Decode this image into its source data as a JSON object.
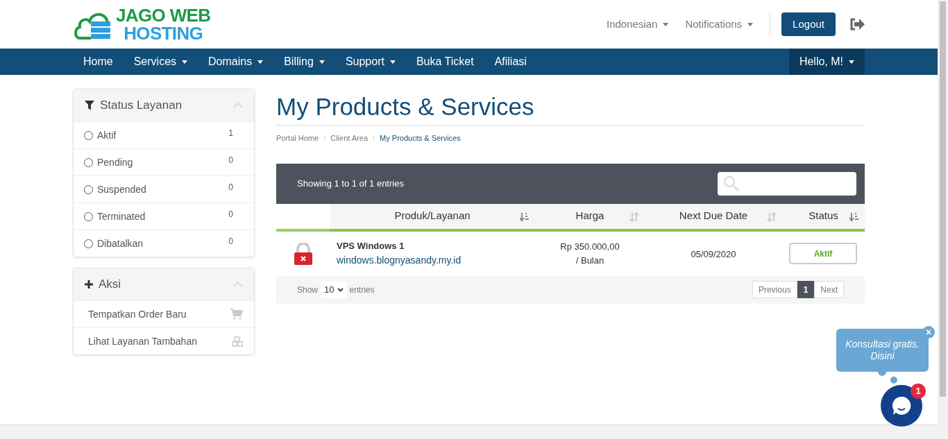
{
  "logo": {
    "line1": "JAGO WEB",
    "line2": "HOSTING"
  },
  "top_links": [
    {
      "label": "Indonesian",
      "dropdown": true
    },
    {
      "label": "Notifications",
      "dropdown": true
    }
  ],
  "logout": "Logout",
  "nav": [
    {
      "label": "Home",
      "dropdown": false
    },
    {
      "label": "Services",
      "dropdown": true
    },
    {
      "label": "Domains",
      "dropdown": true
    },
    {
      "label": "Billing",
      "dropdown": true
    },
    {
      "label": "Support",
      "dropdown": true
    },
    {
      "label": "Buka Ticket",
      "dropdown": false
    },
    {
      "label": "Afiliasi",
      "dropdown": false
    }
  ],
  "user_menu": {
    "label": "Hello, M!",
    "dropdown": true
  },
  "status_panel": {
    "title": "Status Layanan",
    "items": [
      {
        "label": "Aktif",
        "count": "1",
        "selected": false
      },
      {
        "label": "Pending",
        "count": "0",
        "selected": false
      },
      {
        "label": "Suspended",
        "count": "0",
        "selected": false
      },
      {
        "label": "Terminated",
        "count": "0",
        "selected": false
      },
      {
        "label": "Dibatalkan",
        "count": "0",
        "selected": false
      }
    ]
  },
  "actions_panel": {
    "title": "Aksi",
    "items": [
      {
        "label": "Tempatkan Order Baru",
        "kind": "order"
      },
      {
        "label": "Lihat Layanan Tambahan",
        "kind": "addons"
      }
    ]
  },
  "page_title": "My Products & Services",
  "breadcrumb": [
    {
      "label": "Portal Home",
      "selected": false
    },
    {
      "separator": "/",
      "label": "Client Area",
      "selected": false
    },
    {
      "separator": "/",
      "label": "My Products & Services",
      "selected": true
    }
  ],
  "table": {
    "info": "Showing 1 to 1 of 1 entries",
    "columns": [
      {
        "label": "Produk/Layanan",
        "sorted": true
      },
      {
        "label": "Harga",
        "sorted": false
      },
      {
        "label": "Next Due Date",
        "sorted": false
      },
      {
        "label": "Status",
        "sorted": true
      }
    ],
    "rows": [
      {
        "product": "VPS Windows 1",
        "domain": "windows.blognyasandy.my.id",
        "price": "Rp 350.000,00",
        "cycle": "/ Bulan",
        "due": "05/09/2020",
        "status": "Aktif"
      }
    ],
    "show_label": "Show",
    "page_size": "10",
    "entries_label": "entries",
    "pagination": [
      {
        "label": "Previous",
        "selected": false
      },
      {
        "label": "1",
        "selected": true
      },
      {
        "label": "Next",
        "selected": false
      }
    ]
  },
  "chat": {
    "bubble": "Konsultasi gratis. Disini",
    "badge": "1",
    "close": "×"
  }
}
